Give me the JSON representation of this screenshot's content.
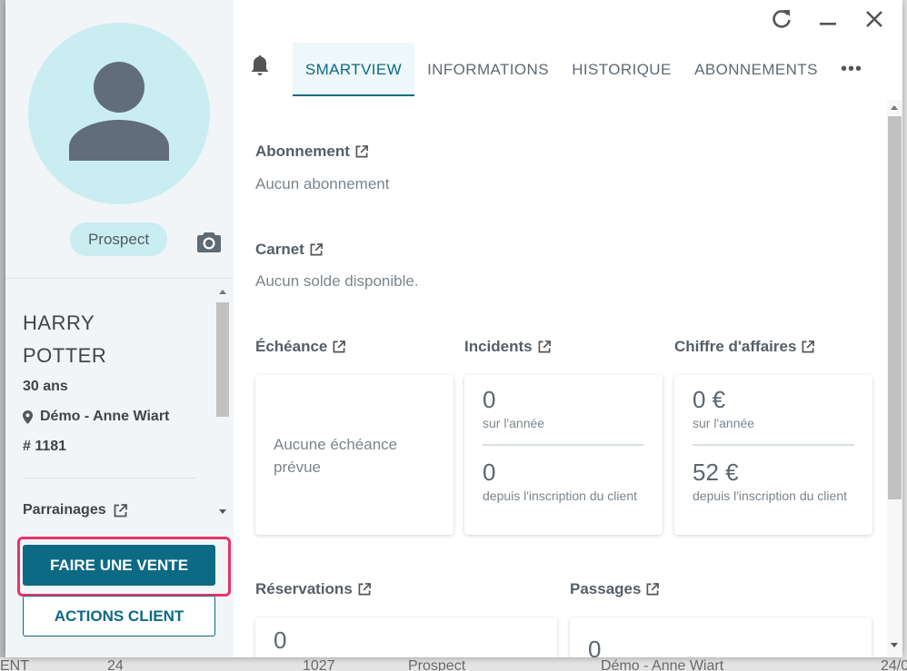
{
  "background_row": {
    "cells": [
      "ENT",
      "24",
      "1027",
      "Prospect",
      "Démo - Anne Wiart",
      "24/0"
    ]
  },
  "client": {
    "status_badge": "Prospect",
    "first_name": "HARRY",
    "last_name": "POTTER",
    "age": "30 ans",
    "location": "Démo - Anne Wiart",
    "number": "# 1181",
    "parrainages_label": "Parrainages"
  },
  "buttons": {
    "sale": "FAIRE UNE VENTE",
    "actions": "ACTIONS CLIENT"
  },
  "tabs": [
    {
      "label": "SMARTVIEW",
      "active": true
    },
    {
      "label": "INFORMATIONS",
      "active": false
    },
    {
      "label": "HISTORIQUE",
      "active": false
    },
    {
      "label": "ABONNEMENTS",
      "active": false
    }
  ],
  "more_label": "•••",
  "sections": {
    "abonnement": {
      "title": "Abonnement",
      "text": "Aucun abonnement"
    },
    "carnet": {
      "title": "Carnet",
      "text": "Aucun solde disponible."
    },
    "echeance": {
      "title": "Échéance",
      "empty": "Aucune échéance prévue"
    },
    "incidents": {
      "title": "Incidents",
      "year_value": "0",
      "year_label": "sur l'année",
      "total_value": "0",
      "total_label": "depuis l'inscription du client"
    },
    "chiffre": {
      "title": "Chiffre d'affaires",
      "year_value": "0 €",
      "year_label": "sur l'année",
      "total_value": "52 €",
      "total_label": "depuis l'inscription du client"
    },
    "reservations": {
      "title": "Réservations",
      "value": "0"
    },
    "passages": {
      "title": "Passages",
      "value": "0"
    }
  },
  "colors": {
    "accent": "#0d6a84",
    "highlight": "#e8336a",
    "avatar_bg": "#caedf1"
  }
}
